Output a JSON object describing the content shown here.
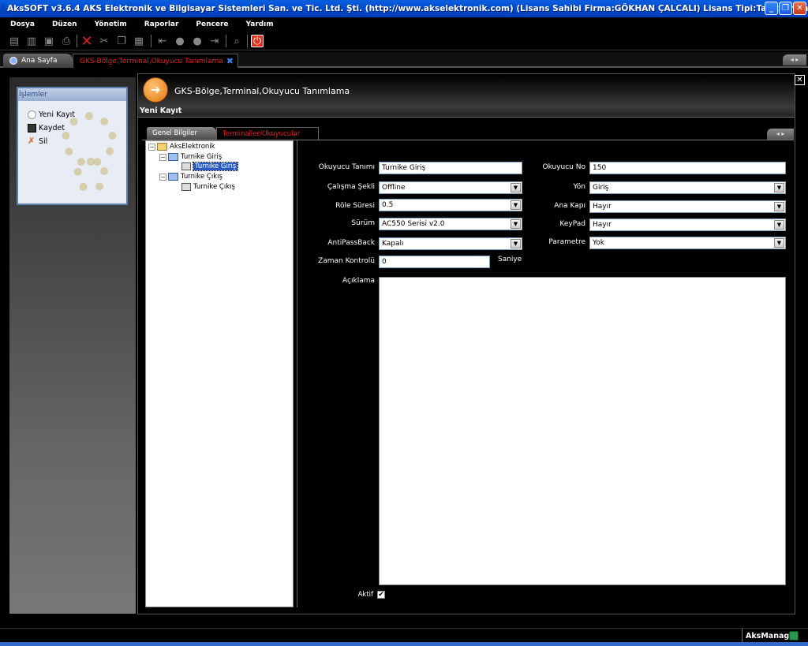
{
  "window": {
    "title": "AksSOFT v3.6.4 AKS Elektronik ve Bilgisayar Sistemleri San. ve Tic. Ltd. Şti. (http://www.akselektronik.com)      (Lisans Sahibi Firma:GÖKHAN ÇALCALI)  Lisans Tipi:Tam Sürüm)",
    "minimize": "_",
    "restore": "❐",
    "close": "✕"
  },
  "menu": [
    "Dosya",
    "Düzen",
    "Yönetim",
    "Raporlar",
    "Pencere",
    "Yardım"
  ],
  "doc_tabs": {
    "home": "Ana Sayfa",
    "active": "GKS-Bölge,Terminal,Okuyucu Tanımlama",
    "close_glyph": "✖",
    "nav": "◂ ▸"
  },
  "left_panel": {
    "header": "İşlemler",
    "items": [
      "Yeni Kayıt",
      "Kaydet",
      "Sil"
    ]
  },
  "main": {
    "title": "GKS-Bölge,Terminal,Okuyucu  Tanımlama",
    "close_glyph": "✕",
    "record_status": "Yeni Kayıt",
    "tabs": [
      "Genel Bilgiler",
      "Terminaller/Okuyucular"
    ],
    "tab_nav": "◂ ▸"
  },
  "tree": {
    "root": "AksElektronik",
    "nodes": [
      {
        "label": "Turnike Giriş",
        "child": "Turnike Giriş"
      },
      {
        "label": "Turnike Çıkış",
        "child": "Turnike Çıkış"
      }
    ],
    "expand_glyph": "−"
  },
  "form": {
    "okuyucu_tanimi_label": "Okuyucu Tanımı",
    "okuyucu_tanimi_value": "Turnike Giriş",
    "okuyucu_no_label": "Okuyucu No",
    "okuyucu_no_value": "150",
    "calisma_sekli_label": "Çalışma Şekli",
    "calisma_sekli_value": "Offline",
    "yon_label": "Yön",
    "yon_value": "Giriş",
    "role_suresi_label": "Röle Süresi",
    "role_suresi_value": "0.5",
    "ana_kapi_label": "Ana Kapı",
    "ana_kapi_value": "Hayır",
    "surum_label": "Sürüm",
    "surum_value": "AC550 Serisi v2.0",
    "keypad_label": "KeyPad",
    "keypad_value": "Hayır",
    "antipassback_label": "AntiPassBack",
    "antipassback_value": "Kapalı",
    "parametre_label": "Parametre",
    "parametre_value": "Yok",
    "zaman_kontrolu_label": "Zaman Kontrolü",
    "zaman_kontrolu_value": "0",
    "zaman_unit": "Saniye",
    "aciklama_label": "Açıklama",
    "aktif_label": "Aktif",
    "aktif_checked": "✔",
    "dropdown_arrow": "▼"
  },
  "status": {
    "app": "AksManager"
  }
}
